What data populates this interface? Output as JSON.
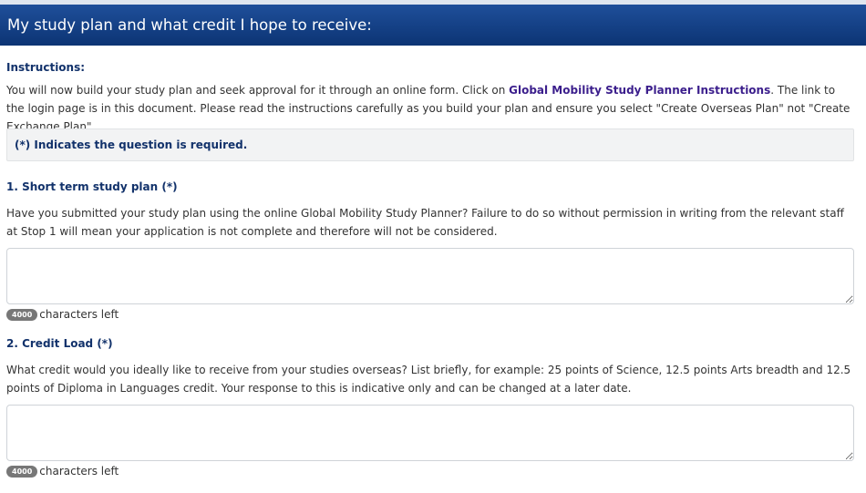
{
  "header": {
    "title": "My study plan and what credit I hope to receive:"
  },
  "instructions": {
    "heading": "Instructions:",
    "text_before_link": "You will now build your study plan and seek approval for it through an online form. Click on ",
    "link_label": "Global Mobility Study Planner Instructions",
    "text_after_link": ". The link to the login page is in this document. Please read the instructions carefully as you build your plan and ensure you select \"Create Overseas Plan\" not \"Create Exchange Plan\"."
  },
  "required_note": "(*) Indicates the question is required.",
  "questions": [
    {
      "heading": "1. Short term study plan  (*)",
      "description": "Have you submitted your study plan using the online Global Mobility Study Planner? Failure to do so without permission in writing from the relevant staff at Stop 1 will mean your application is not complete and therefore will not be considered.",
      "answer_value": "",
      "chars_left": "4000",
      "chars_left_label": "characters left"
    },
    {
      "heading": "2. Credit Load  (*)",
      "description": "What credit would you ideally like to receive from your studies overseas? List briefly, for example: 25 points of Science, 12.5 points Arts breadth and 12.5 points of Diploma in Languages credit. Your response to this is indicative only and can be changed at a later date.",
      "answer_value": "",
      "chars_left": "4000",
      "chars_left_label": "characters left"
    }
  ],
  "colors": {
    "header_bg": "#0c3474",
    "heading_text": "#12326b",
    "link_text": "#3b1e8c",
    "badge_bg": "#777777"
  }
}
